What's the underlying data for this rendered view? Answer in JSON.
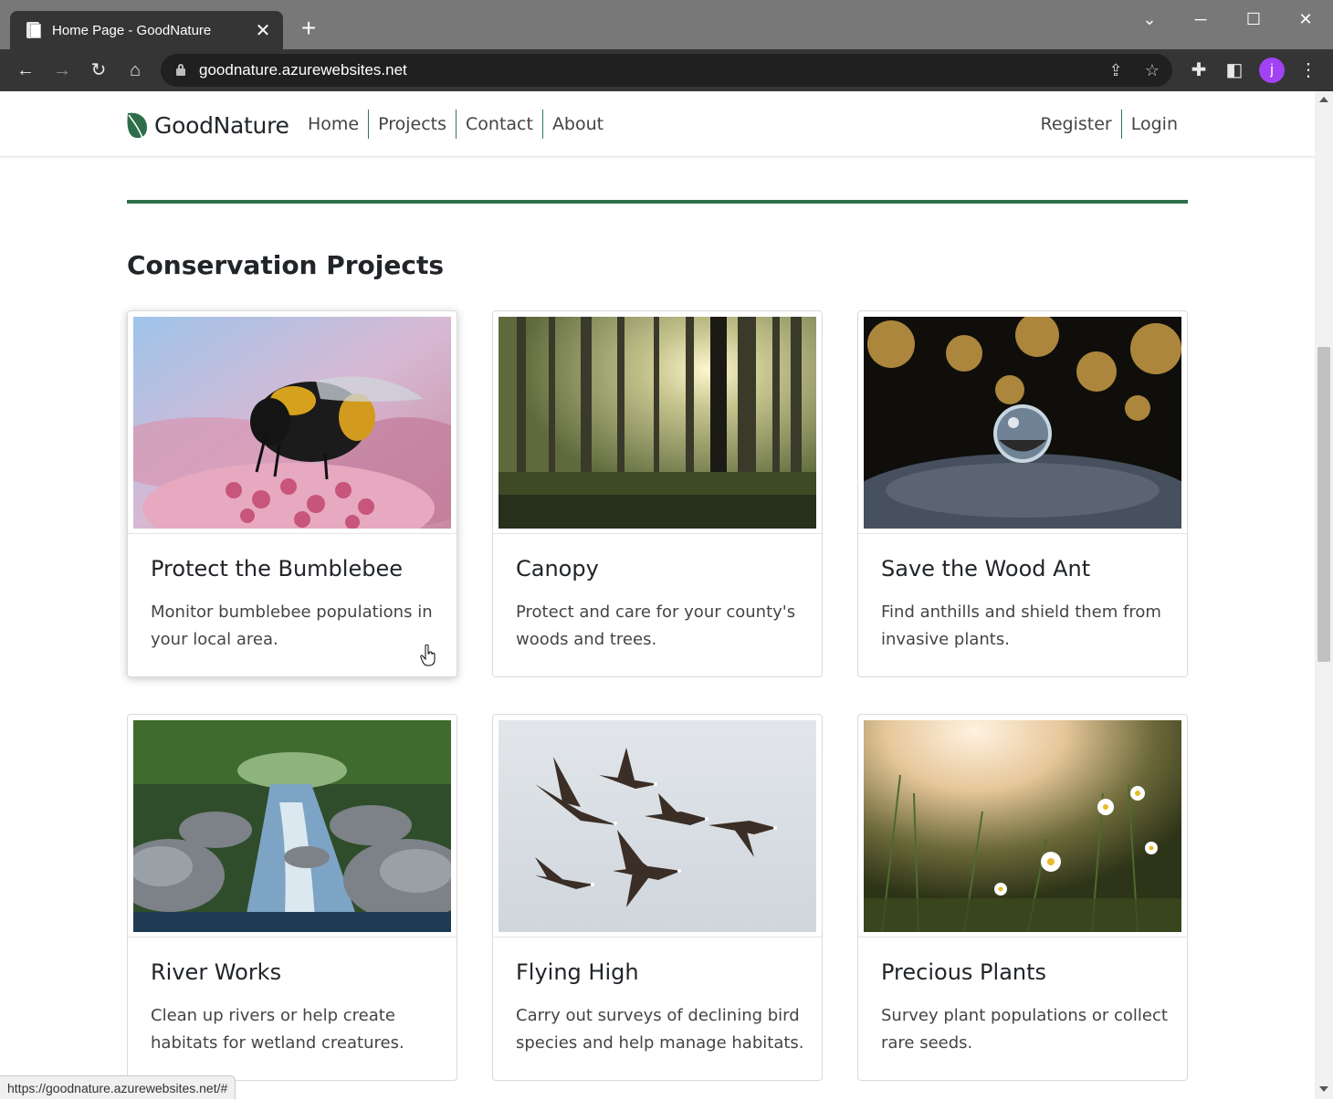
{
  "browser": {
    "tab_title": "Home Page - GoodNature",
    "new_tab": "+",
    "url": "goodnature.azurewebsites.net",
    "profile_initial": "j",
    "status_url": "https://goodnature.azurewebsites.net/#"
  },
  "site": {
    "brand": "GoodNature",
    "brand_color": "#2e6e4a",
    "nav": [
      "Home",
      "Projects",
      "Contact",
      "About"
    ],
    "auth": [
      "Register",
      "Login"
    ]
  },
  "section": {
    "title": "Conservation Projects"
  },
  "projects": [
    {
      "title": "Protect the Bumblebee",
      "text": "Monitor bumblebee populations in your local area.",
      "image": "bumblebee-photo"
    },
    {
      "title": "Canopy",
      "text": "Protect and care for your county's woods and trees.",
      "image": "forest-photo"
    },
    {
      "title": "Save the Wood Ant",
      "text": "Find anthills and shield them from invasive plants.",
      "image": "water-droplet-ant-photo"
    },
    {
      "title": "River Works",
      "text": "Clean up rivers or help create habitats for wetland creatures.",
      "image": "river-photo"
    },
    {
      "title": "Flying High",
      "text": "Carry out surveys of declining bird species and help manage habitats.",
      "image": "geese-photo"
    },
    {
      "title": "Precious Plants",
      "text": "Survey plant populations or collect rare seeds.",
      "image": "wildflowers-photo"
    }
  ]
}
